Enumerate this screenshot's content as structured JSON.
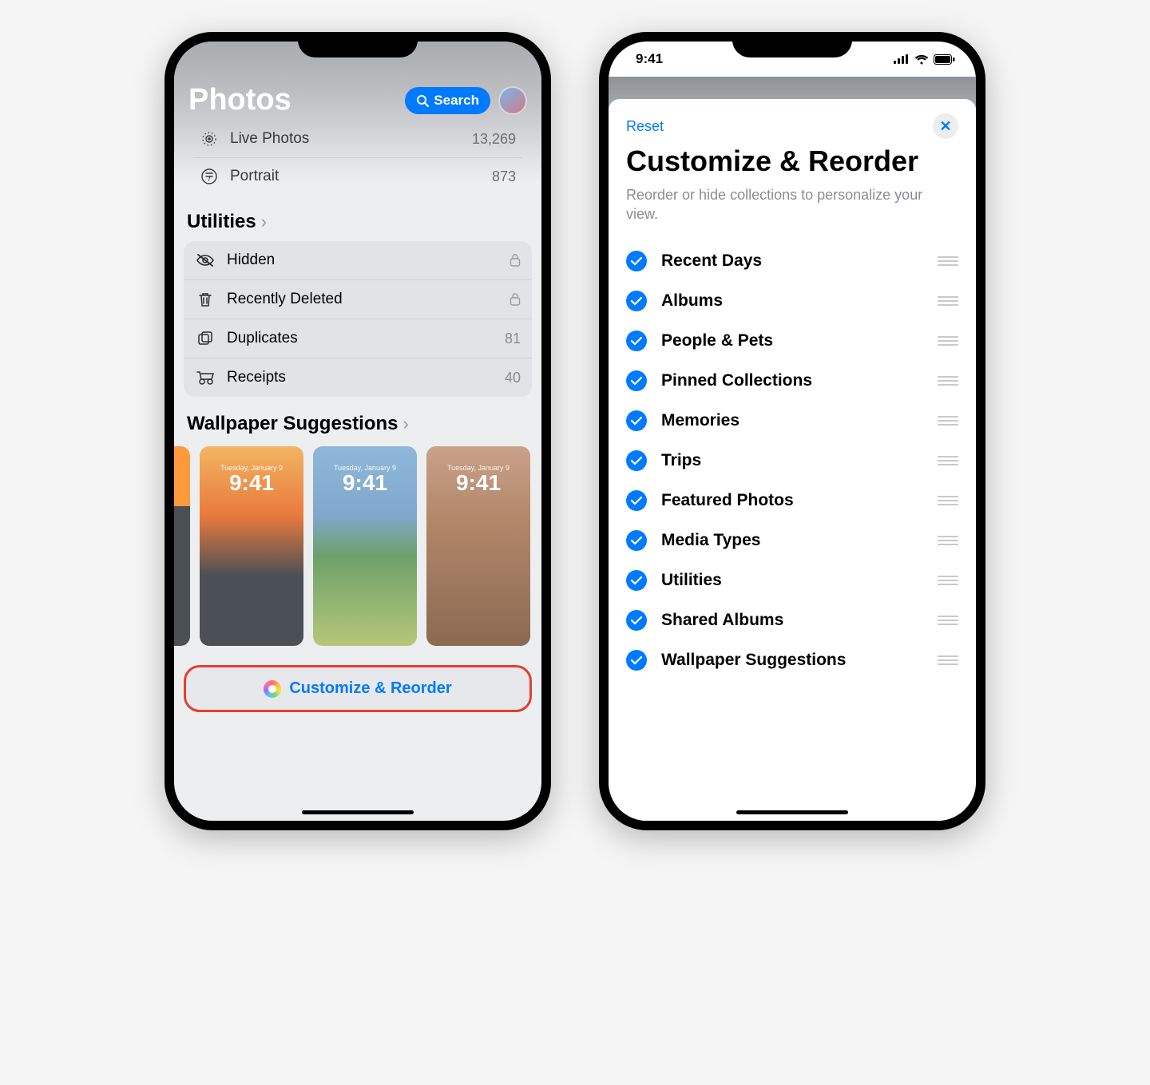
{
  "status_time": "9:41",
  "left": {
    "title": "Photos",
    "search_label": "Search",
    "media_types": [
      {
        "label": "Live Photos",
        "count": "13,269"
      },
      {
        "label": "Portrait",
        "count": "873"
      }
    ],
    "utilities_title": "Utilities",
    "utilities": [
      {
        "label": "Hidden",
        "trailing": "lock"
      },
      {
        "label": "Recently Deleted",
        "trailing": "lock"
      },
      {
        "label": "Duplicates",
        "trailing": "81"
      },
      {
        "label": "Receipts",
        "trailing": "40"
      }
    ],
    "wallpaper_title": "Wallpaper Suggestions",
    "wp_date": "Tuesday, January 9",
    "wp_time": "9:41",
    "button_label": "Customize & Reorder"
  },
  "right": {
    "reset": "Reset",
    "title": "Customize & Reorder",
    "subtitle": "Reorder or hide collections to personalize your view.",
    "options": [
      "Recent Days",
      "Albums",
      "People & Pets",
      "Pinned Collections",
      "Memories",
      "Trips",
      "Featured Photos",
      "Media Types",
      "Utilities",
      "Shared Albums",
      "Wallpaper Suggestions"
    ]
  }
}
